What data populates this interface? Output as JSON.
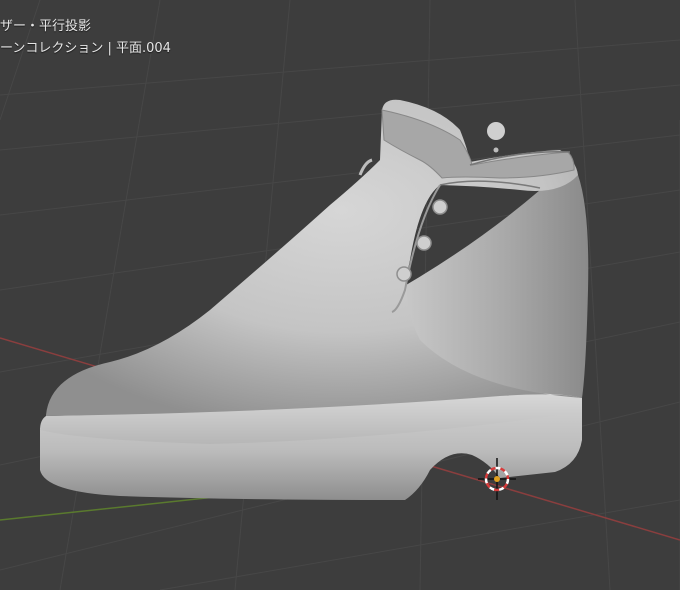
{
  "viewport": {
    "view_label": "ザー・平行投影",
    "collection_label": "ーンコレクション | 平面.004"
  },
  "colors": {
    "background": "#3d3d3d",
    "grid": "#464646",
    "x_axis": "#8a3e3e",
    "y_axis": "#5a7a2e",
    "model": "#c4c4c4",
    "cursor_red": "#d83a3a"
  }
}
